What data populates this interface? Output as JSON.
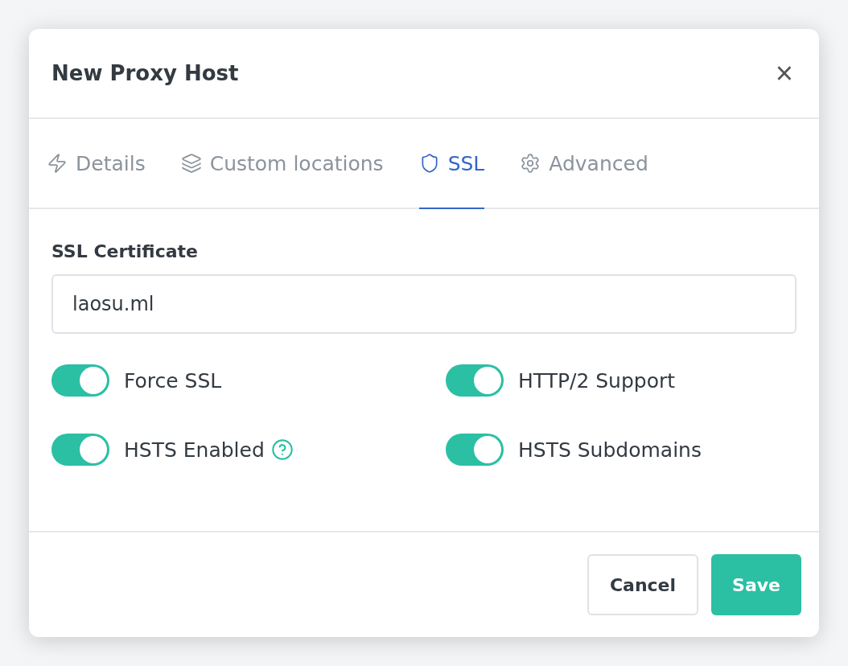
{
  "dialog": {
    "title": "New Proxy Host",
    "close": "×"
  },
  "tabs": [
    {
      "label": "Details",
      "selected": false
    },
    {
      "label": "Custom locations",
      "selected": false
    },
    {
      "label": "SSL",
      "selected": true
    },
    {
      "label": "Advanced",
      "selected": false
    }
  ],
  "certificate": {
    "label": "SSL Certificate",
    "value": "laosu.ml"
  },
  "toggles": [
    {
      "label": "Force SSL",
      "on": true,
      "help": false
    },
    {
      "label": "HTTP/2 Support",
      "on": true,
      "help": false
    },
    {
      "label": "HSTS Enabled",
      "on": true,
      "help": true
    },
    {
      "label": "HSTS Subdomains",
      "on": true,
      "help": false
    }
  ],
  "buttons": [
    {
      "label": "Cancel",
      "kind": "secondary"
    },
    {
      "label": "Save",
      "kind": "primary"
    }
  ]
}
